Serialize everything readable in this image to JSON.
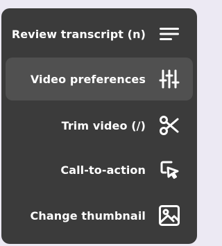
{
  "menu": {
    "items": [
      {
        "label": "Review transcript (n)",
        "icon": "menu-lines-icon",
        "active": false
      },
      {
        "label": "Video preferences",
        "icon": "sliders-icon",
        "active": true
      },
      {
        "label": "Trim video (/)",
        "icon": "scissors-icon",
        "active": false
      },
      {
        "label": "Call-to-action",
        "icon": "cursor-click-icon",
        "active": false
      },
      {
        "label": "Change thumbnail",
        "icon": "image-icon",
        "active": false
      }
    ]
  },
  "colors": {
    "page_background": "#ece9f3",
    "menu_background": "#3b3b3b",
    "active_item_background": "#505050",
    "text": "#ffffff"
  }
}
